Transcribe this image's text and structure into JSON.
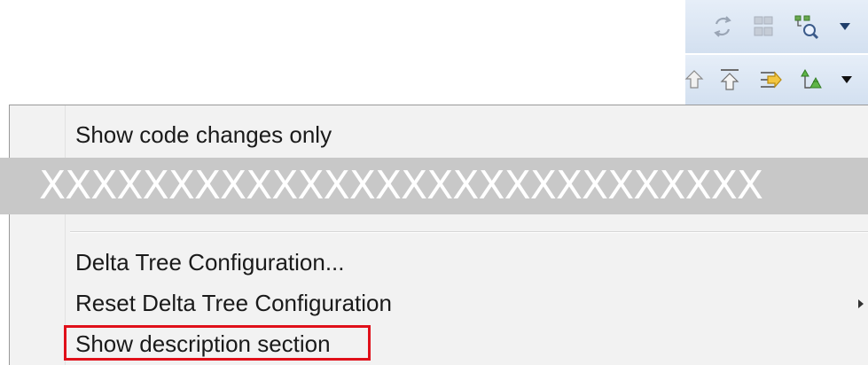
{
  "toolbar_top": {
    "buttons": [
      {
        "icon": "sync-icon",
        "name": "sync-button"
      },
      {
        "icon": "layout-icon",
        "name": "layout-button"
      },
      {
        "icon": "tree-search-icon",
        "name": "tree-search-button"
      },
      {
        "icon": "dropdown-arrow-icon",
        "name": "view-menu-dropdown"
      }
    ]
  },
  "toolbar_bottom": {
    "buttons": [
      {
        "icon": "up-arrow-icon",
        "name": "previous-button"
      },
      {
        "icon": "go-into-icon",
        "name": "go-into-button"
      },
      {
        "icon": "export-icon",
        "name": "export-button"
      },
      {
        "icon": "tree-icon",
        "name": "tree-button"
      },
      {
        "icon": "dropdown-arrow-icon",
        "name": "toolbar-dropdown"
      }
    ]
  },
  "menu": {
    "items": [
      {
        "label": "Show code changes only"
      },
      {
        "label": "Delta Tree Configuration..."
      },
      {
        "label": "Reset Delta Tree Configuration",
        "has_submenu": true
      },
      {
        "label": "Show description section",
        "highlighted": true
      }
    ]
  },
  "redaction": {
    "text": "XXXXXXXXXXXXXXXXXXXXXXXXXXXX"
  },
  "colors": {
    "highlight": "#e0101a",
    "toolbar": "#dce6f2",
    "menu_bg": "#f2f2f2",
    "redaction_bg": "#c8c8c8"
  }
}
